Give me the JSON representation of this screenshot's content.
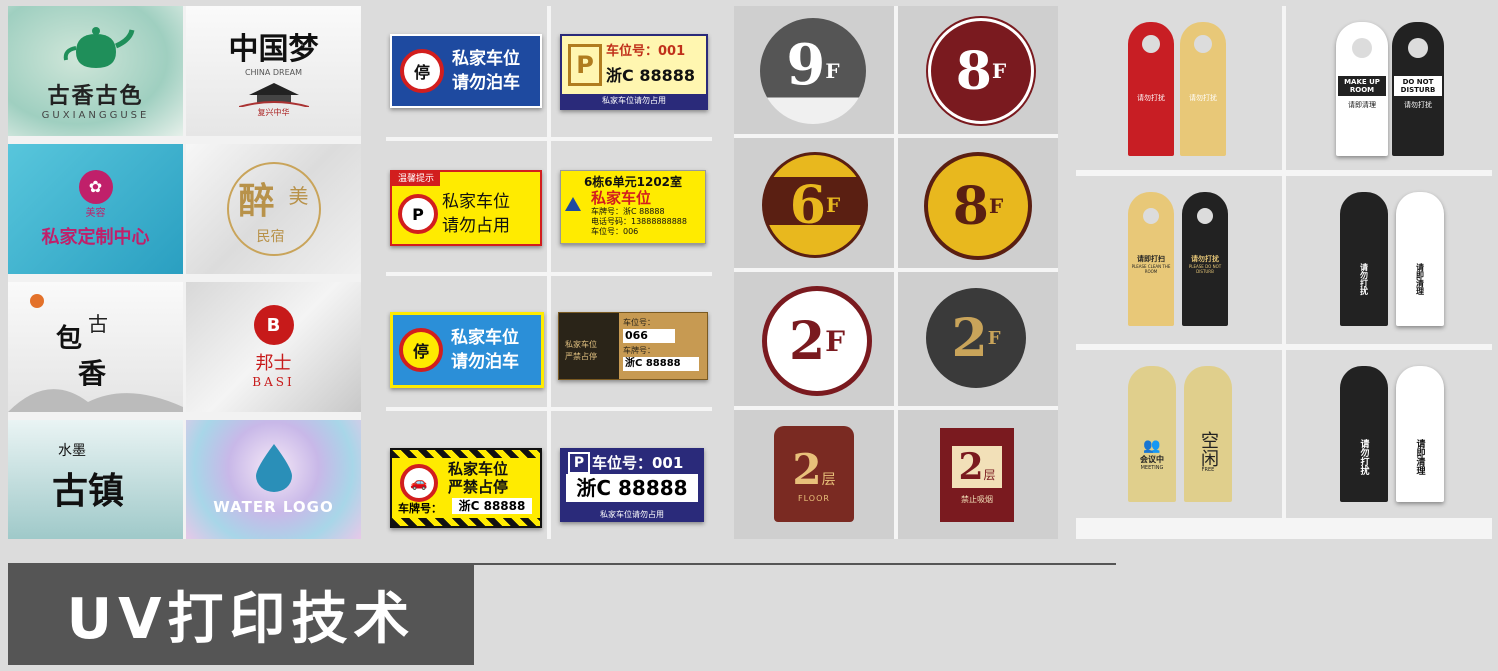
{
  "colors": {
    "background": "#dcdcdc",
    "banner": "#555555",
    "blue": "#1e4aa0",
    "yellow": "#ffeb00",
    "red": "#d21e1e",
    "darkred": "#7a1a1f",
    "gold": "#c9a45a",
    "navy": "#2a2a7a"
  },
  "logos": {
    "tea": {
      "name": "古香古色",
      "latin": "GUXIANGGUSE",
      "seal": "茶"
    },
    "dream": {
      "name": "中国梦",
      "latin": "CHINA DREAM",
      "sub": "复兴中华"
    },
    "custom": {
      "name": "私家定制中心",
      "side": "美容"
    },
    "zuimei": {
      "a": "醉",
      "b": "美",
      "c": "民宿"
    },
    "basi": {
      "mark": "B",
      "cn": "邦士",
      "en": "BASI"
    },
    "ink": {
      "a": "包",
      "b": "古",
      "c": "香"
    },
    "town": {
      "small": "水墨",
      "big": "古镇"
    },
    "water": {
      "text": "WATER LOGO"
    }
  },
  "parking": {
    "sign1": {
      "icon": "停",
      "line1": "私家车位",
      "line2": "请勿泊车"
    },
    "sign2": {
      "p": "P",
      "label": "车位号：001",
      "plate": "浙C 88888",
      "footer": "私家车位请勿占用"
    },
    "sign3": {
      "tip": "温馨提示",
      "line1": "私家车位",
      "line2": "请勿占用"
    },
    "sign4": {
      "addr": "6栋6单元1202室",
      "title": "私家车位",
      "plate": "车牌号：浙C 88888",
      "phone": "电话号码：13888888888",
      "num": "车位号：006"
    },
    "sign5": {
      "icon": "停",
      "line1": "私家车位",
      "line2": "请勿泊车"
    },
    "sign6": {
      "label": "车位号：",
      "num": "066",
      "plateLabel": "车牌号：",
      "plate": "浙C 88888",
      "left1": "私家车位",
      "left2": "严禁占停"
    },
    "sign7": {
      "line1": "私家车位",
      "line2": "严禁占停",
      "plateLabel": "车牌号：",
      "plate": "浙C 88888"
    },
    "sign8": {
      "p": "P",
      "label": "车位号：001",
      "plate": "浙C 88888",
      "footer": "私家车位请勿占用"
    }
  },
  "floors": {
    "f9": {
      "num": "9",
      "suffix": "F"
    },
    "f8a": {
      "num": "8",
      "suffix": "F"
    },
    "f6": {
      "num": "6",
      "suffix": "F"
    },
    "f8b": {
      "num": "8",
      "suffix": "F"
    },
    "f2a": {
      "num": "2",
      "suffix": "F"
    },
    "f2b": {
      "num": "2",
      "suffix": "F"
    },
    "f2c": {
      "num": "2",
      "suffix": "层",
      "sub": "FLOOR"
    },
    "f2d": {
      "num": "2",
      "suffix": "层",
      "sub": "禁止吸烟"
    }
  },
  "hangers": {
    "h1": {
      "left": "请勿打扰",
      "right": "请勿打扰"
    },
    "h2": {
      "left": "MAKE UP ROOM",
      "right": "DO NOT DISTURB",
      "leftcn": "请即清理",
      "rightcn": "请勿打扰"
    },
    "h3": {
      "left": "请即打扫",
      "right": "请勿打扰",
      "leftEn": "PLEASE CLEAN THE ROOM",
      "rightEn": "PLEASE DO NOT DISTURB"
    },
    "h4": {
      "left": "请勿打扰",
      "right": "请即清理"
    },
    "h5": {
      "left": "会议中",
      "right": "空闲",
      "leftEn": "MEETING",
      "rightEn": "FREE"
    },
    "h6": {
      "left": "请勿打扰",
      "right": "请即清理"
    }
  },
  "banner": {
    "title": "UV打印技术"
  }
}
